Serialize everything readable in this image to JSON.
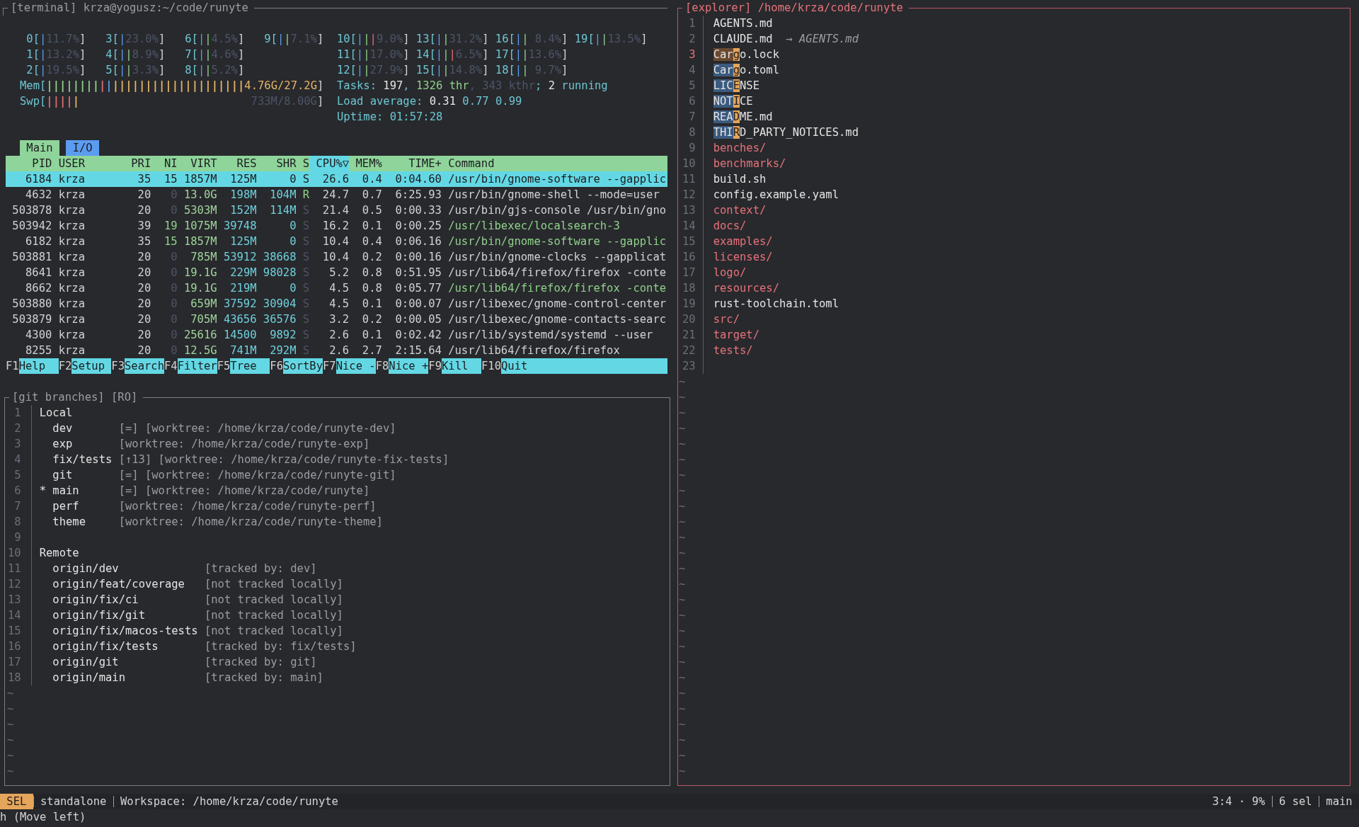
{
  "terminal": {
    "title": "[terminal] krza@yogusz:~/code/runyte",
    "htop": {
      "cpu_columns": [
        [
          {
            "label": "0[",
            "bar": "|",
            "value": "11.7%]"
          },
          {
            "label": "1[",
            "bar": "|",
            "value": "13.2%]"
          },
          {
            "label": "2[",
            "bar": "|",
            "value": "19.5%]"
          }
        ],
        [
          {
            "label": "3[",
            "bar": "|",
            "value": "23.0%]"
          },
          {
            "label": "4[",
            "bar": "||",
            "value": "8.9%]"
          },
          {
            "label": "5[",
            "bar": "||",
            "value": "3.3%]"
          }
        ],
        [
          {
            "label": "6[",
            "bar": "||",
            "value": "4.5%]"
          },
          {
            "label": "7[",
            "bar": "||",
            "value": "4.6%]"
          },
          {
            "label": "8[",
            "bar": "||",
            "value": "5.2%]"
          }
        ],
        [
          {
            "label": "9[",
            "bar": "||",
            "value": "7.1%]"
          }
        ],
        [
          {
            "label": "10[",
            "bar": "|||",
            "value": "9.0%]"
          },
          {
            "label": "11[",
            "bar": "||",
            "value": "17.0%]"
          },
          {
            "label": "12[",
            "bar": "||",
            "value": "27.9%]"
          }
        ],
        [
          {
            "label": "13[",
            "bar": "||",
            "value": "31.2%]"
          },
          {
            "label": "14[",
            "bar": "|||",
            "value": "6.5%]"
          },
          {
            "label": "15[",
            "bar": "||",
            "value": "14.8%]"
          }
        ],
        [
          {
            "label": "16[",
            "bar": "||",
            "value": "8.4%]"
          },
          {
            "label": "17[",
            "bar": "||",
            "value": "13.6%]"
          },
          {
            "label": "18[",
            "bar": "||",
            "value": "9.7%]"
          }
        ],
        [
          {
            "label": "19[",
            "bar": "||",
            "value": "13.5%]"
          }
        ]
      ],
      "memory": {
        "label": "Mem[",
        "segments": [
          {
            "text": "||||||||",
            "color": "#8fd18a"
          },
          {
            "text": "|",
            "color": "#e06c75"
          },
          {
            "text": "|",
            "color": "#5b9cf0"
          },
          {
            "text": "||||||||||||||||||||",
            "color": "#e5b567"
          }
        ],
        "value": "4.76G/27.2G]"
      },
      "swap": {
        "label": "Swp[",
        "segments": [
          {
            "text": "||||",
            "color": "#e06c75"
          },
          {
            "text": "|",
            "color": "#e5b567"
          }
        ],
        "value": "733M/8.00G]"
      },
      "info_lines": [
        [
          {
            "text": "Tasks: ",
            "color": "#6cc6d2"
          },
          {
            "text": "197",
            "color": "#e4e4e4"
          },
          {
            "text": ", ",
            "color": "#6cc6d2"
          },
          {
            "text": "1326 thr",
            "color": "#8fd18a"
          },
          {
            "text": ", 343 kthr",
            "color": "#4c5566"
          },
          {
            "text": "; ",
            "color": "#6cc6d2"
          },
          {
            "text": "2",
            "color": "#e4e4e4"
          },
          {
            "text": " running",
            "color": "#6cc6d2"
          }
        ],
        [
          {
            "text": "Load average: ",
            "color": "#6cc6d2"
          },
          {
            "text": "0.31",
            "color": "#e4e4e4"
          },
          {
            "text": " 0.77 0.99",
            "color": "#6cc6d2"
          }
        ],
        [
          {
            "text": "Uptime: 01:57:28",
            "color": "#6cc6d2"
          }
        ]
      ],
      "tabs": [
        {
          "label": "Main",
          "selected": true
        },
        {
          "label": "I/O",
          "selected": false
        }
      ],
      "columns": [
        {
          "label": "PID",
          "sorted": false
        },
        {
          "label": "USER",
          "sorted": false
        },
        {
          "label": "PRI",
          "sorted": false
        },
        {
          "label": "NI",
          "sorted": false
        },
        {
          "label": "VIRT",
          "sorted": false
        },
        {
          "label": "RES",
          "sorted": false
        },
        {
          "label": "SHR",
          "sorted": false
        },
        {
          "label": "S",
          "sorted": false
        },
        {
          "label": "CPU%▽",
          "sorted": true
        },
        {
          "label": "MEM%",
          "sorted": false
        },
        {
          "label": "TIME+",
          "sorted": false
        },
        {
          "label": "Command",
          "sorted": false
        }
      ],
      "rows": [
        {
          "selected": true,
          "niced": true,
          "running": false,
          "thread": false,
          "cells": [
            "6184",
            "krza",
            "35",
            "15",
            "1857M",
            "125M",
            "0",
            "S",
            "26.6",
            "0.4",
            "0:04.60",
            "/usr/bin/gnome-software --gapplic"
          ]
        },
        {
          "selected": false,
          "niced": false,
          "running": true,
          "thread": false,
          "cells": [
            "4632",
            "krza",
            "20",
            "0",
            "13.0G",
            "198M",
            "104M",
            "R",
            "24.7",
            "0.7",
            "6:25.93",
            "/usr/bin/gnome-shell --mode=user"
          ]
        },
        {
          "selected": false,
          "niced": false,
          "running": false,
          "thread": false,
          "cells": [
            "503878",
            "krza",
            "20",
            "0",
            "5303M",
            "152M",
            "114M",
            "S",
            "21.4",
            "0.5",
            "0:00.33",
            "/usr/bin/gjs-console /usr/bin/gno"
          ]
        },
        {
          "selected": false,
          "niced": true,
          "running": false,
          "thread": true,
          "cells": [
            "503942",
            "krza",
            "39",
            "19",
            "1075M",
            "39748",
            "0",
            "S",
            "16.2",
            "0.1",
            "0:00.25",
            "/usr/libexec/localsearch-3"
          ]
        },
        {
          "selected": false,
          "niced": true,
          "running": false,
          "thread": true,
          "cells": [
            "6182",
            "krza",
            "35",
            "15",
            "1857M",
            "125M",
            "0",
            "S",
            "10.4",
            "0.4",
            "0:06.16",
            "/usr/bin/gnome-software --gapplic"
          ]
        },
        {
          "selected": false,
          "niced": false,
          "running": false,
          "thread": false,
          "cells": [
            "503881",
            "krza",
            "20",
            "0",
            "785M",
            "53912",
            "38668",
            "S",
            "10.4",
            "0.2",
            "0:00.16",
            "/usr/bin/gnome-clocks --gapplicat"
          ]
        },
        {
          "selected": false,
          "niced": false,
          "running": false,
          "thread": false,
          "cells": [
            "8641",
            "krza",
            "20",
            "0",
            "19.1G",
            "229M",
            "98028",
            "S",
            "5.2",
            "0.8",
            "0:51.95",
            "/usr/lib64/firefox/firefox -conte"
          ]
        },
        {
          "selected": false,
          "niced": false,
          "running": false,
          "thread": true,
          "cells": [
            "8662",
            "krza",
            "20",
            "0",
            "19.1G",
            "219M",
            "0",
            "S",
            "4.5",
            "0.8",
            "0:05.77",
            "/usr/lib64/firefox/firefox -conte"
          ]
        },
        {
          "selected": false,
          "niced": false,
          "running": false,
          "thread": false,
          "cells": [
            "503880",
            "krza",
            "20",
            "0",
            "659M",
            "37592",
            "30904",
            "S",
            "4.5",
            "0.1",
            "0:00.07",
            "/usr/libexec/gnome-control-center"
          ]
        },
        {
          "selected": false,
          "niced": false,
          "running": false,
          "thread": false,
          "cells": [
            "503879",
            "krza",
            "20",
            "0",
            "705M",
            "43656",
            "36576",
            "S",
            "3.2",
            "0.2",
            "0:00.05",
            "/usr/libexec/gnome-contacts-searc"
          ]
        },
        {
          "selected": false,
          "niced": false,
          "running": false,
          "thread": false,
          "cells": [
            "4300",
            "krza",
            "20",
            "0",
            "25616",
            "14500",
            "9892",
            "S",
            "2.6",
            "0.1",
            "0:02.42",
            "/usr/lib/systemd/systemd --user"
          ]
        },
        {
          "selected": false,
          "niced": false,
          "running": false,
          "thread": false,
          "cells": [
            "8255",
            "krza",
            "20",
            "0",
            "12.5G",
            "741M",
            "292M",
            "S",
            "2.6",
            "2.7",
            "2:15.64",
            "/usr/lib64/firefox/firefox"
          ]
        }
      ],
      "function_keys": [
        {
          "key": "F1",
          "label": "Help"
        },
        {
          "key": "F2",
          "label": "Setup"
        },
        {
          "key": "F3",
          "label": "Search"
        },
        {
          "key": "F4",
          "label": "Filter"
        },
        {
          "key": "F5",
          "label": "Tree"
        },
        {
          "key": "F6",
          "label": "SortBy"
        },
        {
          "key": "F7",
          "label": "Nice -"
        },
        {
          "key": "F8",
          "label": "Nice +"
        },
        {
          "key": "F9",
          "label": "Kill"
        },
        {
          "key": "F10",
          "label": "Quit"
        }
      ]
    }
  },
  "git_branches": {
    "title": "[git branches] [RO]",
    "lines": [
      {
        "n": "1",
        "kind": "heading",
        "text": "Local"
      },
      {
        "n": "2",
        "kind": "local",
        "name": "dev",
        "info": "[=] [worktree: /home/krza/code/runyte-dev]"
      },
      {
        "n": "3",
        "kind": "local",
        "name": "exp",
        "info": "[worktree: /home/krza/code/runyte-exp]"
      },
      {
        "n": "4",
        "kind": "local",
        "name": "fix/tests",
        "info": "[↑13] [worktree: /home/krza/code/runyte-fix-tests]"
      },
      {
        "n": "5",
        "kind": "local",
        "name": "git",
        "info": "[=] [worktree: /home/krza/code/runyte-git]"
      },
      {
        "n": "6",
        "kind": "local",
        "marker": "*",
        "name": "main",
        "info": "[=] [worktree: /home/krza/code/runyte]"
      },
      {
        "n": "7",
        "kind": "local",
        "name": "perf",
        "info": "[worktree: /home/krza/code/runyte-perf]"
      },
      {
        "n": "8",
        "kind": "local",
        "name": "theme",
        "info": "[worktree: /home/krza/code/runyte-theme]"
      },
      {
        "n": "9",
        "kind": "blank"
      },
      {
        "n": "10",
        "kind": "heading",
        "text": "Remote"
      },
      {
        "n": "11",
        "kind": "remote",
        "name": "origin/dev",
        "info": "[tracked by: dev]"
      },
      {
        "n": "12",
        "kind": "remote",
        "name": "origin/feat/coverage",
        "info": "[not tracked locally]"
      },
      {
        "n": "13",
        "kind": "remote",
        "name": "origin/fix/ci",
        "info": "[not tracked locally]"
      },
      {
        "n": "14",
        "kind": "remote",
        "name": "origin/fix/git",
        "info": "[not tracked locally]"
      },
      {
        "n": "15",
        "kind": "remote",
        "name": "origin/fix/macos-tests",
        "info": "[not tracked locally]"
      },
      {
        "n": "16",
        "kind": "remote",
        "name": "origin/fix/tests",
        "info": "[tracked by: fix/tests]"
      },
      {
        "n": "17",
        "kind": "remote",
        "name": "origin/git",
        "info": "[tracked by: git]"
      },
      {
        "n": "18",
        "kind": "remote",
        "name": "origin/main",
        "info": "[tracked by: main]"
      }
    ],
    "empty_line_markers": [
      "~",
      "~",
      "~",
      "~",
      "~",
      "~"
    ]
  },
  "explorer": {
    "title": "[explorer] /home/krza/code/runyte",
    "lines": [
      {
        "n": "1",
        "kind": "file",
        "current": false,
        "name": "AGENTS.md"
      },
      {
        "n": "2",
        "kind": "link",
        "current": false,
        "name": "CLAUDE.md",
        "target": "→ AGENTS.md"
      },
      {
        "n": "3",
        "kind": "selection",
        "current": true,
        "head": "Car",
        "cursor": "g",
        "tail": "o.lock"
      },
      {
        "n": "4",
        "kind": "selection",
        "current": false,
        "head": "Car",
        "cursor": "g",
        "tail": "o.toml"
      },
      {
        "n": "5",
        "kind": "selection",
        "current": false,
        "head": "LIC",
        "cursor": "E",
        "tail": "NSE"
      },
      {
        "n": "6",
        "kind": "selection",
        "current": false,
        "head": "NOT",
        "cursor": "I",
        "tail": "CE"
      },
      {
        "n": "7",
        "kind": "selection",
        "current": false,
        "head": "REA",
        "cursor": "D",
        "tail": "ME.md"
      },
      {
        "n": "8",
        "kind": "selection",
        "current": false,
        "head": "THI",
        "cursor": "R",
        "tail": "D_PARTY_NOTICES.md"
      },
      {
        "n": "9",
        "kind": "dir",
        "current": false,
        "name": "benches/"
      },
      {
        "n": "10",
        "kind": "dir",
        "current": false,
        "name": "benchmarks/"
      },
      {
        "n": "11",
        "kind": "file",
        "current": false,
        "name": "build.sh"
      },
      {
        "n": "12",
        "kind": "file",
        "current": false,
        "name": "config.example.yaml"
      },
      {
        "n": "13",
        "kind": "dir",
        "current": false,
        "name": "context/"
      },
      {
        "n": "14",
        "kind": "dir",
        "current": false,
        "name": "docs/"
      },
      {
        "n": "15",
        "kind": "dir",
        "current": false,
        "name": "examples/"
      },
      {
        "n": "16",
        "kind": "dir",
        "current": false,
        "name": "licenses/"
      },
      {
        "n": "17",
        "kind": "dir",
        "current": false,
        "name": "logo/"
      },
      {
        "n": "18",
        "kind": "dir",
        "current": false,
        "name": "resources/"
      },
      {
        "n": "19",
        "kind": "file",
        "current": false,
        "name": "rust-toolchain.toml"
      },
      {
        "n": "20",
        "kind": "dir",
        "current": false,
        "name": "src/"
      },
      {
        "n": "21",
        "kind": "dir",
        "current": false,
        "name": "target/"
      },
      {
        "n": "22",
        "kind": "dir",
        "current": false,
        "name": "tests/"
      },
      {
        "n": "23",
        "kind": "empty",
        "current": false
      }
    ],
    "empty_line_markers": [
      "~",
      "~",
      "~",
      "~",
      "~",
      "~",
      "~",
      "~",
      "~",
      "~",
      "~",
      "~",
      "~",
      "~",
      "~",
      "~",
      "~",
      "~",
      "~",
      "~",
      "~",
      "~",
      "~",
      "~",
      "~",
      "~"
    ]
  },
  "status_bar": {
    "mode": "SEL",
    "left": [
      "standalone",
      "Workspace: /home/krza/code/runyte"
    ],
    "right": [
      "3:4 · 9%",
      "6 sel",
      "main"
    ]
  },
  "command_line": "h (Move left)"
}
